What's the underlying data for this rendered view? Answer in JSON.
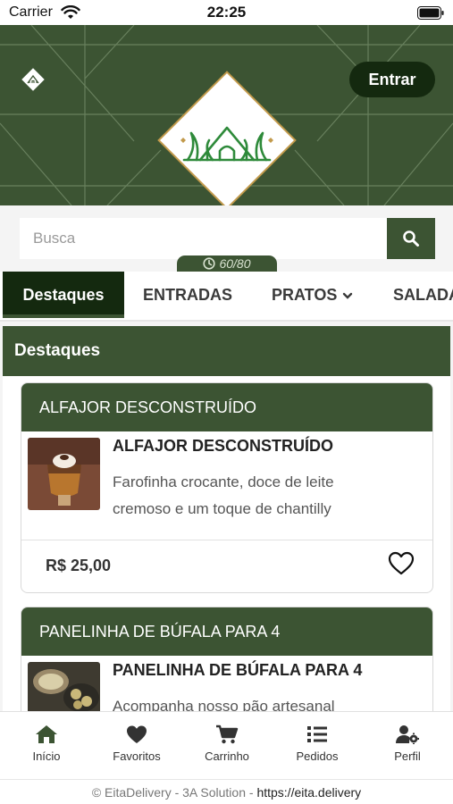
{
  "status_bar": {
    "carrier": "Carrier",
    "time": "22:25"
  },
  "header": {
    "login_label": "Entrar"
  },
  "search": {
    "placeholder": "Busca",
    "value": "",
    "capacity": "60/80"
  },
  "tabs": [
    {
      "label": "Destaques",
      "active": true
    },
    {
      "label": "ENTRADAS"
    },
    {
      "label": "PRATOS"
    },
    {
      "label": "SALADAS"
    }
  ],
  "section": {
    "title": "Destaques"
  },
  "products": [
    {
      "header": "ALFAJOR DESCONSTRUÍDO",
      "name": "ALFAJOR DESCONSTRUÍDO",
      "description": "Farofinha crocante, doce de leite cremoso e um toque de chantilly",
      "price": "R$ 25,00"
    },
    {
      "header": "PANELINHA DE BÚFALA PARA 4",
      "name": "PANELINHA DE BÚFALA PARA 4",
      "description": "Acompanha nosso pão artesanal"
    }
  ],
  "bottom_nav": [
    {
      "label": "Início",
      "icon": "home-icon"
    },
    {
      "label": "Favoritos",
      "icon": "heart-icon"
    },
    {
      "label": "Carrinho",
      "icon": "cart-icon"
    },
    {
      "label": "Pedidos",
      "icon": "list-icon"
    },
    {
      "label": "Perfil",
      "icon": "user-gear-icon"
    }
  ],
  "footer": {
    "text": "© EitaDelivery - 3A Solution - ",
    "link": "https://eita.delivery"
  },
  "colors": {
    "brand_green": "#3c5433",
    "dark_green": "#14290f",
    "logo_gold": "#b88a3a"
  }
}
